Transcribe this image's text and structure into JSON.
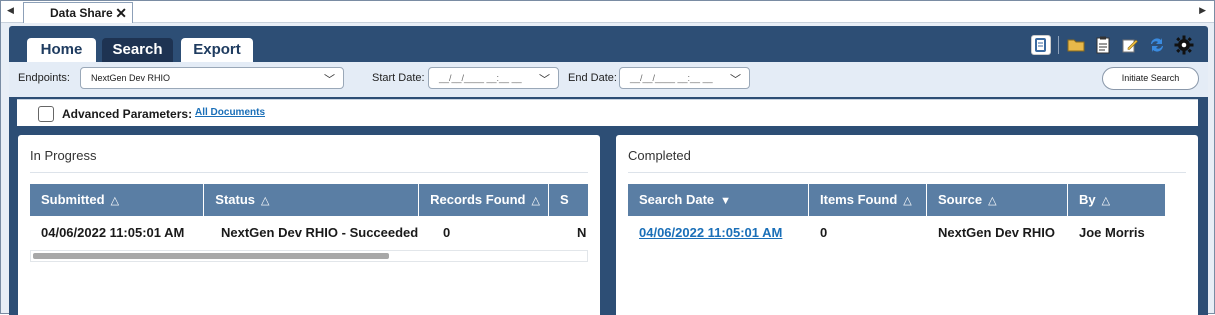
{
  "doc_tabs": [
    {
      "label": "Data Share",
      "close": "✕"
    }
  ],
  "nav_tabs": [
    {
      "label": "Home",
      "active": false
    },
    {
      "label": "Search",
      "active": true
    },
    {
      "label": "Export",
      "active": false
    }
  ],
  "toolbar_icons": [
    "notebook-icon",
    "folder-icon",
    "clipboard-icon",
    "edit-icon",
    "refresh-icon",
    "settings-icon"
  ],
  "criteria": {
    "endpoints_label": "Endpoints:",
    "endpoints_value": "NextGen Dev RHIO",
    "start_date_label": "Start Date:",
    "start_date_placeholder": "__/__/____ __:__ __",
    "end_date_label": "End Date:",
    "end_date_placeholder": "__/__/____ __:__ __",
    "initiate_button": "Initiate Search"
  },
  "advanced": {
    "label": "Advanced Parameters:",
    "link": "All Documents"
  },
  "in_progress": {
    "title": "In Progress",
    "columns": [
      {
        "label": "Submitted",
        "sort": "△"
      },
      {
        "label": "Status",
        "sort": "△"
      },
      {
        "label": "Records Found",
        "sort": "△"
      },
      {
        "label": "S",
        "sort": ""
      }
    ],
    "rows": [
      [
        "04/06/2022 11:05:01 AM",
        "NextGen Dev RHIO - Succeeded",
        "0",
        "N"
      ]
    ]
  },
  "completed": {
    "title": "Completed",
    "columns": [
      {
        "label": "Search Date",
        "sort": "▼"
      },
      {
        "label": "Items Found",
        "sort": "△"
      },
      {
        "label": "Source",
        "sort": "△"
      },
      {
        "label": "By",
        "sort": "△"
      }
    ],
    "rows": [
      [
        "04/06/2022 11:05:01 AM",
        "0",
        "NextGen Dev RHIO",
        "Joe Morris"
      ]
    ]
  },
  "colors": {
    "frame": "#2d4e75",
    "header": "#5a7ea4",
    "link": "#1a6fb8"
  }
}
